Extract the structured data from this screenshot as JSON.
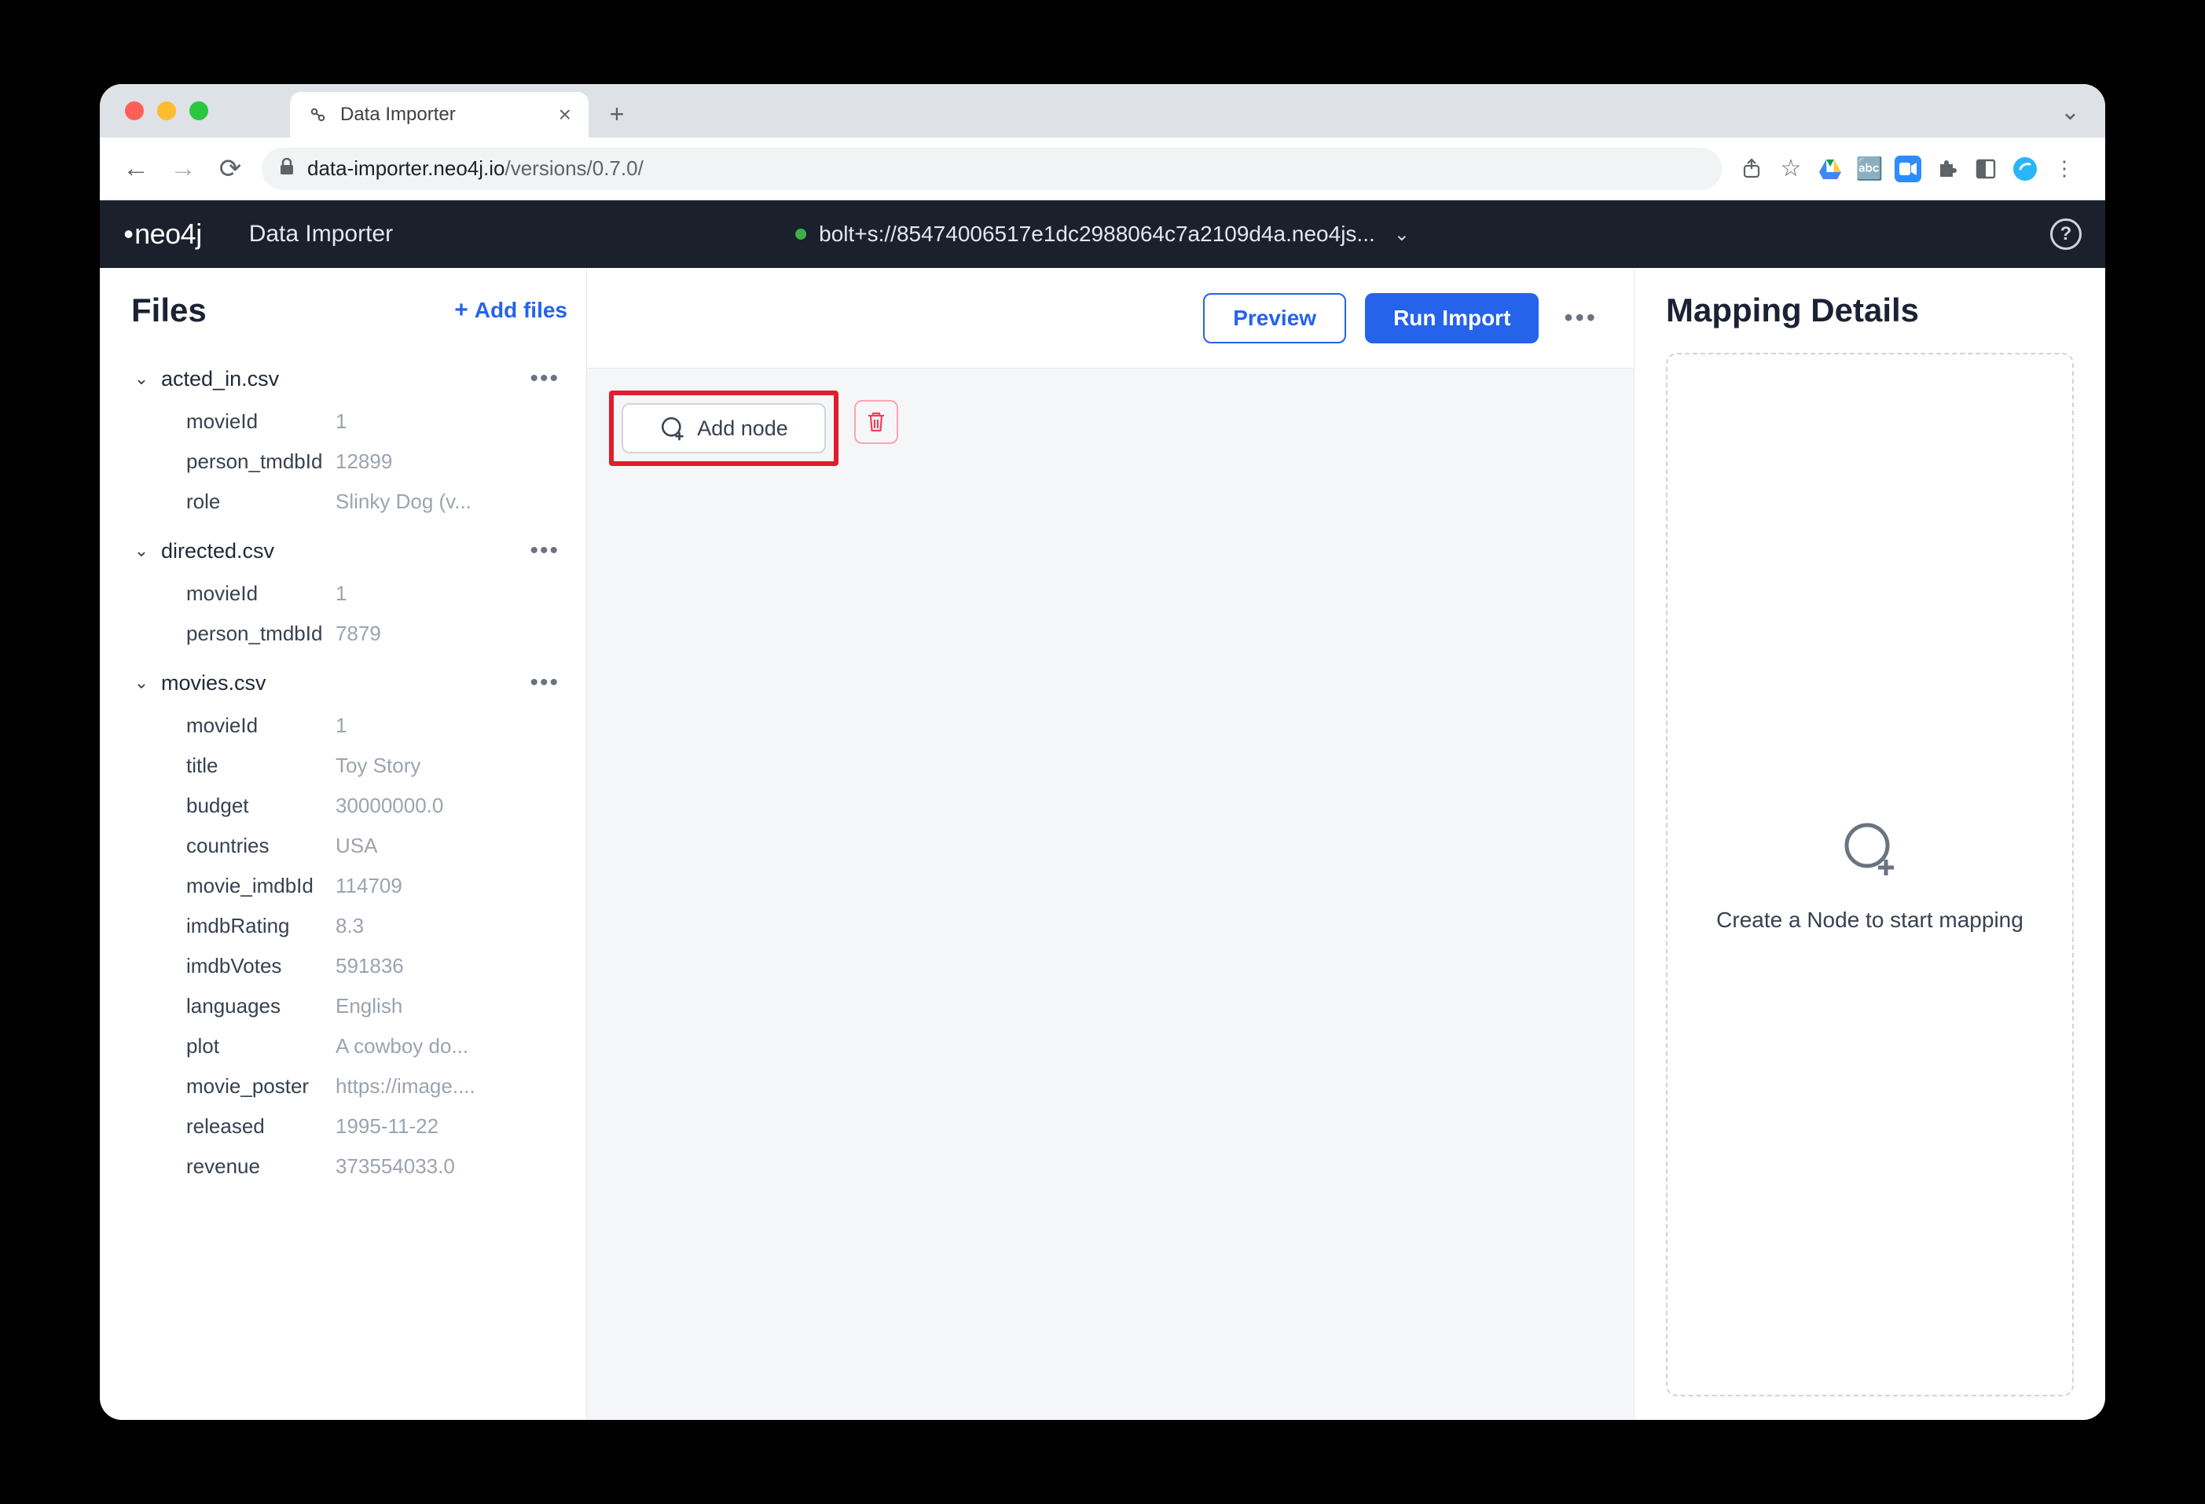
{
  "browser": {
    "tab_title": "Data Importer",
    "url_host": "data-importer.neo4j.io",
    "url_path": "/versions/0.7.0/"
  },
  "header": {
    "logo": "neo4j",
    "app_title": "Data Importer",
    "connection_string": "bolt+s://85474006517e1dc2988064c7a2109d4a.neo4js..."
  },
  "left": {
    "title": "Files",
    "add_files_label": "Add files",
    "files": [
      {
        "name": "acted_in.csv",
        "fields": [
          {
            "key": "movieId",
            "val": "1"
          },
          {
            "key": "person_tmdbId",
            "val": "12899"
          },
          {
            "key": "role",
            "val": "Slinky Dog (v..."
          }
        ]
      },
      {
        "name": "directed.csv",
        "fields": [
          {
            "key": "movieId",
            "val": "1"
          },
          {
            "key": "person_tmdbId",
            "val": "7879"
          }
        ]
      },
      {
        "name": "movies.csv",
        "fields": [
          {
            "key": "movieId",
            "val": "1"
          },
          {
            "key": "title",
            "val": "Toy Story"
          },
          {
            "key": "budget",
            "val": "30000000.0"
          },
          {
            "key": "countries",
            "val": "USA"
          },
          {
            "key": "movie_imdbId",
            "val": "114709"
          },
          {
            "key": "imdbRating",
            "val": "8.3"
          },
          {
            "key": "imdbVotes",
            "val": "591836"
          },
          {
            "key": "languages",
            "val": "English"
          },
          {
            "key": "plot",
            "val": "A cowboy do..."
          },
          {
            "key": "movie_poster",
            "val": "https://image...."
          },
          {
            "key": "released",
            "val": "1995-11-22"
          },
          {
            "key": "revenue",
            "val": "373554033.0"
          }
        ]
      }
    ]
  },
  "center": {
    "preview_label": "Preview",
    "run_import_label": "Run Import",
    "add_node_label": "Add node"
  },
  "right": {
    "title": "Mapping Details",
    "hint": "Create a Node to start mapping"
  }
}
